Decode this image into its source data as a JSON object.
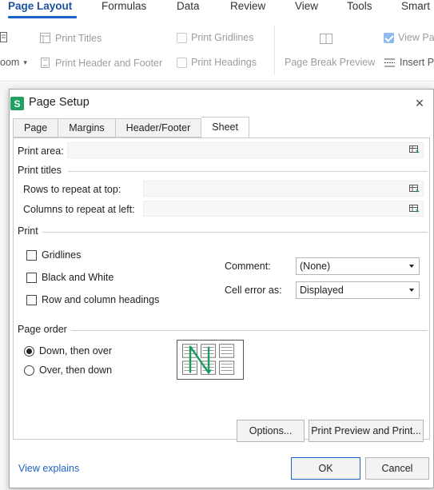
{
  "ribbon": {
    "tabs": [
      "Page Layout",
      "Formulas",
      "Data",
      "Review",
      "View",
      "Tools",
      "Smart"
    ],
    "active_tab": "Page Layout",
    "items": {
      "print_titles": "Print Titles",
      "print_gridlines": "Print Gridlines",
      "view_pa": "View Pa",
      "zoom": "oom",
      "print_header_footer": "Print Header and Footer",
      "print_headings": "Print Headings",
      "page_break_preview": "Page Break Preview",
      "insert_pa": "Insert Pa"
    },
    "accent": "#1b62c5"
  },
  "dialog": {
    "title": "Page Setup",
    "logo_letter": "S",
    "close_label": "×",
    "tabs": [
      "Page",
      "Margins",
      "Header/Footer",
      "Sheet"
    ],
    "active_tab": "Sheet",
    "print_area_label": "Print area:",
    "print_area_value": "",
    "print_titles": {
      "title": "Print titles",
      "rows_label": "Rows to repeat at top:",
      "rows_value": "",
      "cols_label": "Columns to repeat at left:",
      "cols_value": ""
    },
    "print": {
      "title": "Print",
      "gridlines": "Gridlines",
      "black_white": "Black and White",
      "row_col_headings": "Row and column headings",
      "comment_label": "Comment:",
      "comment_value": "(None)",
      "cell_error_label": "Cell error as:",
      "cell_error_value": "Displayed"
    },
    "page_order": {
      "title": "Page order",
      "down_then_over": "Down, then over",
      "over_then_down": "Over, then down",
      "selected": "Down, then over"
    },
    "buttons": {
      "options": "Options...",
      "print_preview": "Print Preview and Print...",
      "ok": "OK",
      "cancel": "Cancel"
    },
    "view_explains": "View explains",
    "logo_color": "#20a162",
    "order_arrow_color": "#1a9a5a"
  }
}
